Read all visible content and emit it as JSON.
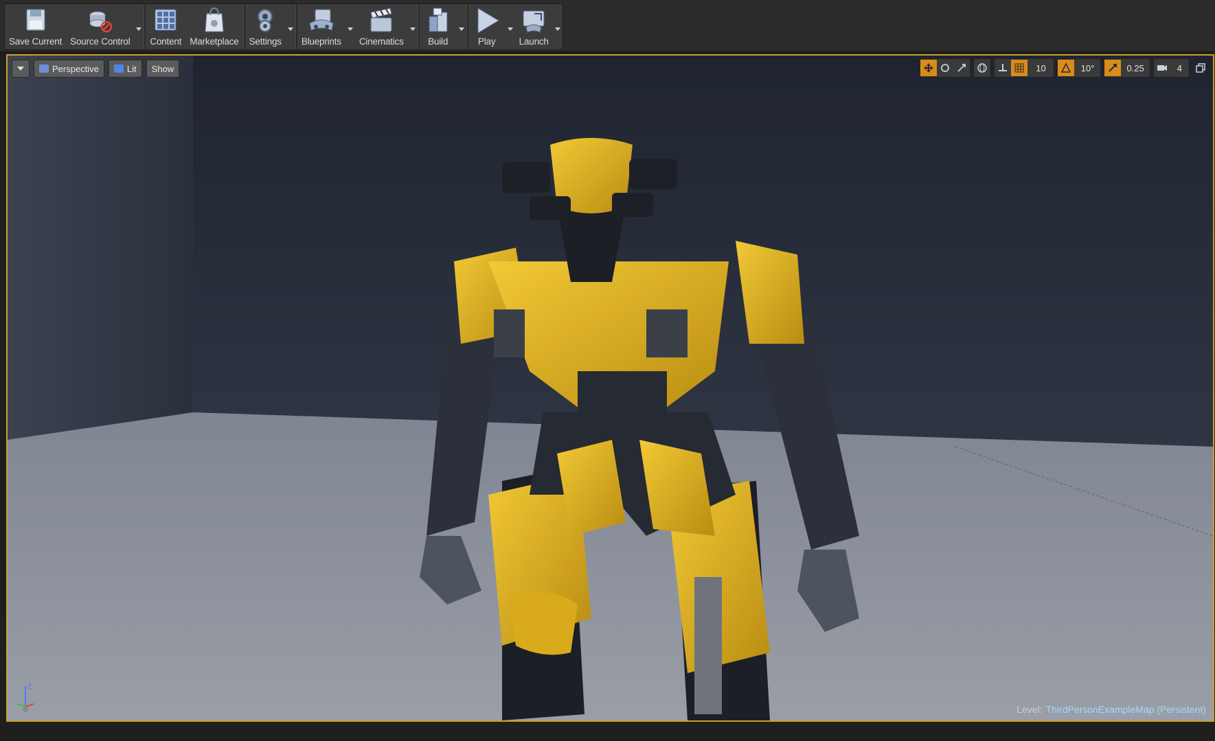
{
  "toolbar": {
    "buttons": [
      {
        "label": "Save Current",
        "icon": "save-icon"
      },
      {
        "label": "Source Control",
        "icon": "source-control-icon"
      },
      {
        "label": "Content",
        "icon": "content-icon"
      },
      {
        "label": "Marketplace",
        "icon": "marketplace-icon"
      },
      {
        "label": "Settings",
        "icon": "settings-icon"
      },
      {
        "label": "Blueprints",
        "icon": "blueprints-icon"
      },
      {
        "label": "Cinematics",
        "icon": "cinematics-icon"
      },
      {
        "label": "Build",
        "icon": "build-icon"
      },
      {
        "label": "Play",
        "icon": "play-icon"
      },
      {
        "label": "Launch",
        "icon": "launch-icon"
      }
    ]
  },
  "viewport": {
    "view_mode": "Perspective",
    "lighting": "Lit",
    "show": "Show",
    "grid_snap": "10",
    "rotation_snap": "10°",
    "scale_snap": "0.25",
    "camera_speed": "4",
    "level_label": "Level:",
    "level_name": "ThirdPersonExampleMap (Persistent)"
  },
  "colors": {
    "accent": "#c9a227",
    "active_tool": "#d98c1a",
    "robot_yellow": "#e5b522",
    "level_name": "#a6d8ff"
  }
}
